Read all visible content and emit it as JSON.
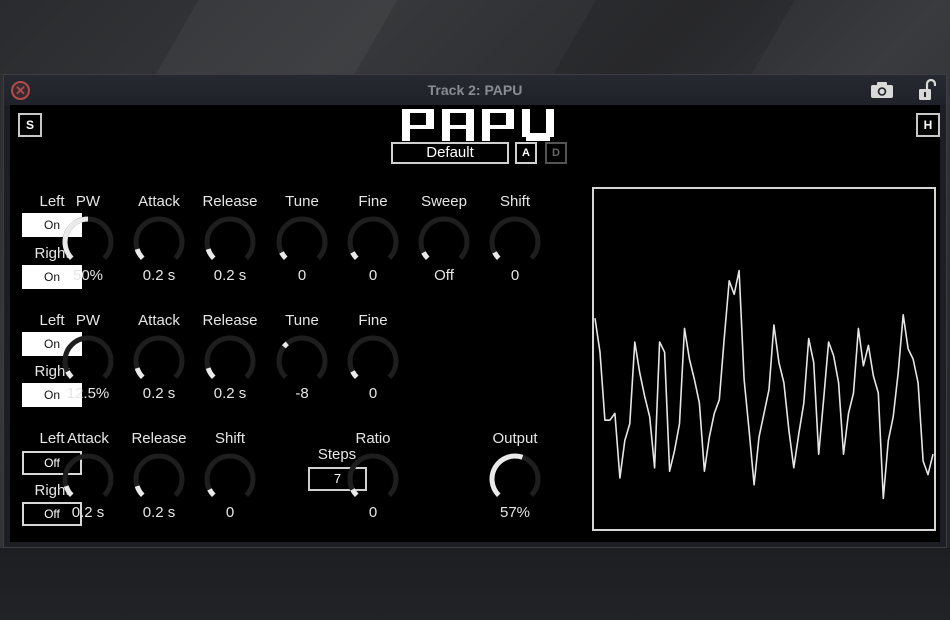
{
  "window": {
    "title": "Track 2: PAPU",
    "close_icon": "close-x-icon",
    "camera_icon": "camera-icon",
    "lock_icon": "unlocked-padlock-icon"
  },
  "header": {
    "logo_text": "PAPU",
    "s_button": "S",
    "h_button": "H",
    "preset": "Default",
    "a_button": "A",
    "d_button": "D"
  },
  "channel1": {
    "left_label": "Left",
    "left_value": "On",
    "right_label": "Right",
    "right_value": "On",
    "knobs": [
      {
        "label": "PW",
        "value": "50%",
        "fraction": 0.5
      },
      {
        "label": "Attack",
        "value": "0.2 s",
        "fraction": 0.1
      },
      {
        "label": "Release",
        "value": "0.2 s",
        "fraction": 0.1
      },
      {
        "label": "Tune",
        "value": "0",
        "fraction": 0.0
      },
      {
        "label": "Fine",
        "value": "0",
        "fraction": 0.0
      },
      {
        "label": "Sweep",
        "value": "Off",
        "fraction": 0.0
      },
      {
        "label": "Shift",
        "value": "0",
        "fraction": 0.0
      }
    ]
  },
  "channel2": {
    "left_label": "Left",
    "left_value": "On",
    "right_label": "Right",
    "right_value": "On",
    "knobs": [
      {
        "label": "PW",
        "value": "12.5%",
        "fraction": 0.0
      },
      {
        "label": "Attack",
        "value": "0.2 s",
        "fraction": 0.1
      },
      {
        "label": "Release",
        "value": "0.2 s",
        "fraction": 0.1
      },
      {
        "label": "Tune",
        "value": "-8",
        "fraction": 0.33,
        "marker_only": true
      },
      {
        "label": "Fine",
        "value": "0",
        "fraction": 0.0
      }
    ]
  },
  "channel3": {
    "left_label": "Left",
    "left_value": "Off",
    "right_label": "Right",
    "right_value": "Off",
    "knobs": [
      {
        "label": "Attack",
        "value": "0.2 s",
        "fraction": 0.1
      },
      {
        "label": "Release",
        "value": "0.2 s",
        "fraction": 0.1
      },
      {
        "label": "Shift",
        "value": "0",
        "fraction": 0.0
      }
    ],
    "steps_label": "Steps",
    "steps_value": "7",
    "ratio": {
      "label": "Ratio",
      "value": "0",
      "fraction": 0.0
    }
  },
  "output": {
    "label": "Output",
    "value": "57%",
    "fraction": 0.57
  },
  "scope": {
    "waveform": [
      0.62,
      0.52,
      0.32,
      0.32,
      0.34,
      0.15,
      0.26,
      0.31,
      0.55,
      0.46,
      0.39,
      0.33,
      0.18,
      0.55,
      0.52,
      0.17,
      0.23,
      0.31,
      0.59,
      0.5,
      0.44,
      0.37,
      0.17,
      0.27,
      0.34,
      0.38,
      0.56,
      0.73,
      0.69,
      0.76,
      0.44,
      0.29,
      0.13,
      0.27,
      0.34,
      0.41,
      0.6,
      0.49,
      0.43,
      0.29,
      0.18,
      0.28,
      0.37,
      0.56,
      0.49,
      0.22,
      0.38,
      0.55,
      0.51,
      0.43,
      0.22,
      0.34,
      0.4,
      0.59,
      0.48,
      0.54,
      0.45,
      0.4,
      0.09,
      0.26,
      0.33,
      0.46,
      0.63,
      0.53,
      0.5,
      0.43,
      0.2,
      0.16,
      0.22
    ]
  },
  "colors": {
    "panel_bg": "#000000",
    "foreground": "#e6e6e6",
    "knob_track": "#1e1e1e",
    "knob_fill": "#eaeaea",
    "close": "#b24a4a"
  }
}
